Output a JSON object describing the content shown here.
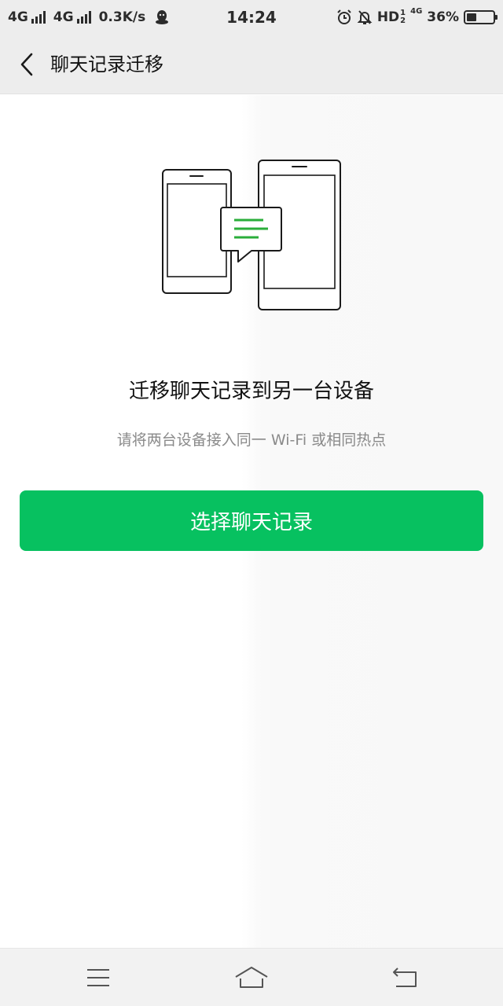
{
  "status_bar": {
    "network1": "4G",
    "network2": "4G",
    "speed": "0.3K/s",
    "time": "14:24",
    "hd": "HD",
    "hd_sup": "1",
    "hd_sub": "2",
    "net_small": "4G",
    "battery_percent": "36%",
    "battery_level": 0.36,
    "icons": [
      "signal-icon",
      "signal-icon",
      "qq-icon",
      "alarm-icon",
      "mute-bell-icon",
      "battery-icon"
    ]
  },
  "nav": {
    "title": "聊天记录迁移",
    "back_icon": "chevron-left-icon"
  },
  "main": {
    "illustration_icon": "phones-transfer-icon",
    "heading": "迁移聊天记录到另一台设备",
    "subtext": "请将两台设备接入同一 Wi-Fi 或相同热点",
    "button_label": "选择聊天记录"
  },
  "system_nav": {
    "icons": [
      "menu-icon",
      "home-icon",
      "back-icon"
    ]
  },
  "colors": {
    "accent": "#07C160",
    "bar_bg": "#EDEDED",
    "subtext": "#8A8A8A"
  }
}
